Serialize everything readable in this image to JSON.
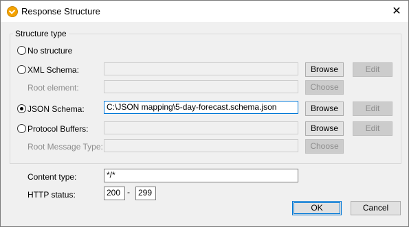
{
  "window": {
    "title": "Response Structure",
    "close_glyph": "✕",
    "icon": "app-icon"
  },
  "structure": {
    "legend": "Structure type",
    "no_structure": "No structure",
    "xml_schema": {
      "label": "XML Schema:",
      "value": "",
      "browse": "Browse",
      "edit": "Edit"
    },
    "root_element": {
      "label": "Root element:",
      "value": "",
      "choose": "Choose"
    },
    "json_schema": {
      "label": "JSON Schema:",
      "value": "C:\\JSON mapping\\5-day-forecast.schema.json",
      "browse": "Browse",
      "edit": "Edit"
    },
    "protocol_buffers": {
      "label": "Protocol Buffers:",
      "value": "",
      "browse": "Browse",
      "edit": "Edit"
    },
    "root_message_type": {
      "label": "Root Message Type:",
      "value": "",
      "choose": "Choose"
    },
    "selected": "JSON Schema"
  },
  "content_type": {
    "label": "Content type:",
    "value": "*/*"
  },
  "http_status": {
    "label": "HTTP status:",
    "from": "200",
    "separator": "-",
    "to": "299"
  },
  "buttons": {
    "ok": "OK",
    "cancel": "Cancel"
  }
}
